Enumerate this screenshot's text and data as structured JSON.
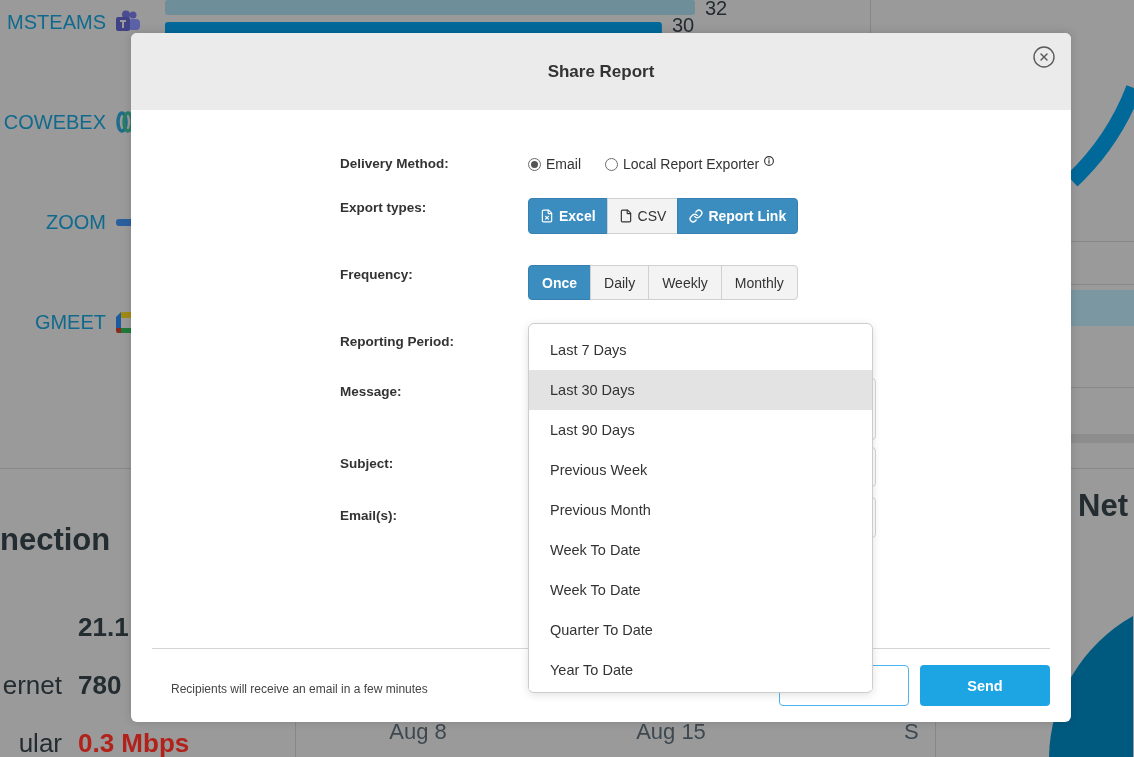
{
  "dashboard": {
    "bar_chart": {
      "chart_data": {
        "type": "bar",
        "orientation": "horizontal",
        "categories": [
          "MSTEAMS",
          "COWEBEX",
          "ZOOM",
          "GMEET"
        ],
        "series": [
          {
            "color": "#6e8e99",
            "values": [
              32,
              null,
              null,
              null
            ]
          },
          {
            "color": "#03699a",
            "values": [
              30,
              null,
              null,
              null
            ]
          }
        ],
        "data_labels": true
      },
      "category_logos": [
        {
          "kind": "teams"
        },
        {
          "kind": "webex"
        },
        {
          "kind": "zoom"
        },
        {
          "kind": "meet"
        }
      ]
    },
    "connection": {
      "title": "nection",
      "rows": [
        {
          "value": "21.1",
          "alert": false
        },
        {
          "label": "ernet",
          "value": "780",
          "alert": false
        },
        {
          "label": "ular",
          "value": "0.3 Mbps",
          "alert": true
        }
      ]
    },
    "date_axis": [
      "Aug 8",
      "Aug 15",
      "S"
    ],
    "network": {
      "title": "Net"
    }
  },
  "dialog": {
    "title": "Share Report",
    "delivery": {
      "label": "Delivery Method:",
      "options": [
        {
          "label": "Email",
          "selected": true,
          "info": false
        },
        {
          "label": "Local Report Exporter",
          "selected": false,
          "info": true
        }
      ]
    },
    "export_types": {
      "label": "Export types:",
      "options": [
        {
          "label": "Excel",
          "kind": "excel",
          "selected": true
        },
        {
          "label": "CSV",
          "kind": "csv",
          "selected": false
        },
        {
          "label": "Report Link",
          "kind": "link",
          "selected": true
        }
      ]
    },
    "frequency": {
      "label": "Frequency:",
      "options": [
        {
          "label": "Once",
          "selected": true
        },
        {
          "label": "Daily",
          "selected": false
        },
        {
          "label": "Weekly",
          "selected": false
        },
        {
          "label": "Monthly",
          "selected": false
        }
      ]
    },
    "reporting_period": {
      "label": "Reporting Period:",
      "options": [
        {
          "label": "Last 7 Days",
          "selected": false
        },
        {
          "label": "Last 30 Days",
          "selected": true
        },
        {
          "label": "Last 90 Days",
          "selected": false
        },
        {
          "label": "Previous Week",
          "selected": false
        },
        {
          "label": "Previous Month",
          "selected": false
        },
        {
          "label": "Week To Date",
          "selected": false
        },
        {
          "label": "Week To Date",
          "selected": false
        },
        {
          "label": "Quarter To Date",
          "selected": false
        },
        {
          "label": "Year To Date",
          "selected": false
        }
      ]
    },
    "message": {
      "label": "Message:"
    },
    "subject": {
      "label": "Subject:"
    },
    "emails": {
      "label": "Email(s):"
    },
    "footer": {
      "note": "Recipients will receive an email in a few minutes",
      "buttons": [
        {
          "kind": "outline"
        },
        {
          "kind": "primary",
          "label": "Send"
        }
      ]
    }
  }
}
